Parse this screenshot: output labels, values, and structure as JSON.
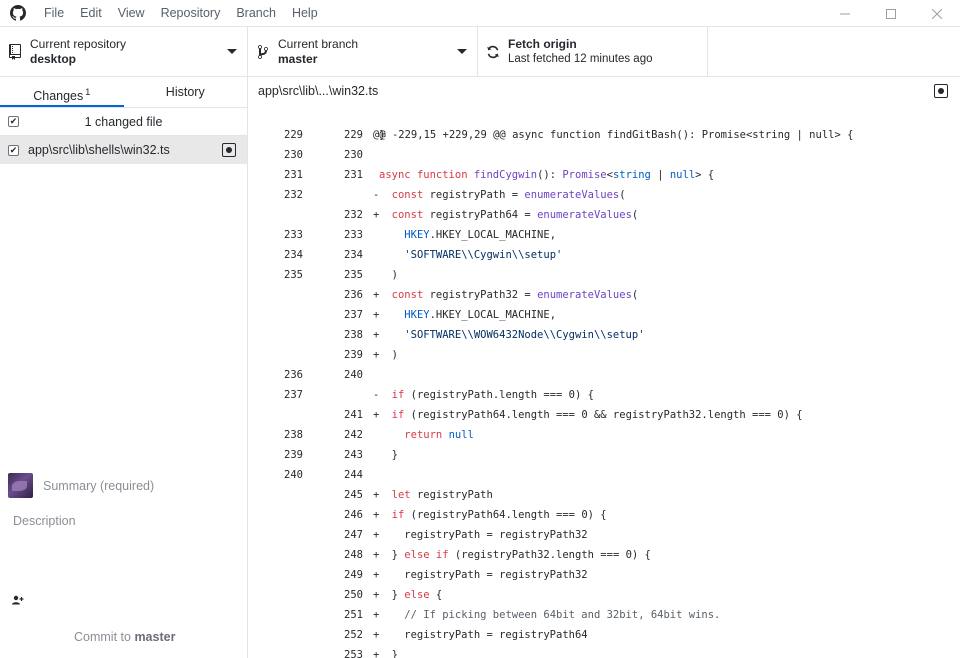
{
  "menu": [
    "File",
    "Edit",
    "View",
    "Repository",
    "Branch",
    "Help"
  ],
  "toolbar": {
    "repo": {
      "desc": "Current repository",
      "name": "desktop"
    },
    "branch": {
      "desc": "Current branch",
      "name": "master"
    },
    "fetch": {
      "title": "Fetch origin",
      "sub": "Last fetched 12 minutes ago"
    }
  },
  "sidebar": {
    "tabs": {
      "changes": "Changes",
      "changes_count": "1",
      "history": "History"
    },
    "changed_files_label": "1 changed file",
    "files": [
      {
        "path": "app\\src\\lib\\shells\\win32.ts"
      }
    ],
    "commit": {
      "summary_placeholder": "Summary (required)",
      "description_placeholder": "Description",
      "coauthor_icon": "+",
      "commit_prefix": "Commit to ",
      "commit_branch": "master"
    }
  },
  "diff": {
    "path": "app\\src\\lib\\...\\win32.ts",
    "hunk": "@@ -229,15 +229,29 @@ async function findGitBash(): Promise<string | null> {",
    "lines": [
      {
        "old": "229",
        "new": "229",
        "m": "",
        "code": "}"
      },
      {
        "old": "230",
        "new": "230",
        "m": "",
        "code": ""
      },
      {
        "old": "231",
        "new": "231",
        "m": "",
        "code": "async function findCygwin(): Promise<string | null> {"
      },
      {
        "old": "232",
        "new": "",
        "m": "-",
        "code": "  const registryPath = enumerateValues("
      },
      {
        "old": "",
        "new": "232",
        "m": "+",
        "code": "  const registryPath64 = enumerateValues("
      },
      {
        "old": "233",
        "new": "233",
        "m": "",
        "code": "    HKEY.HKEY_LOCAL_MACHINE,"
      },
      {
        "old": "234",
        "new": "234",
        "m": "",
        "code": "    'SOFTWARE\\\\Cygwin\\\\setup'"
      },
      {
        "old": "235",
        "new": "235",
        "m": "",
        "code": "  )"
      },
      {
        "old": "",
        "new": "236",
        "m": "+",
        "code": "  const registryPath32 = enumerateValues("
      },
      {
        "old": "",
        "new": "237",
        "m": "+",
        "code": "    HKEY.HKEY_LOCAL_MACHINE,"
      },
      {
        "old": "",
        "new": "238",
        "m": "+",
        "code": "    'SOFTWARE\\\\WOW6432Node\\\\Cygwin\\\\setup'"
      },
      {
        "old": "",
        "new": "239",
        "m": "+",
        "code": "  )"
      },
      {
        "old": "236",
        "new": "240",
        "m": "",
        "code": ""
      },
      {
        "old": "237",
        "new": "",
        "m": "-",
        "code": "  if (registryPath.length === 0) {"
      },
      {
        "old": "",
        "new": "241",
        "m": "+",
        "code": "  if (registryPath64.length === 0 && registryPath32.length === 0) {"
      },
      {
        "old": "238",
        "new": "242",
        "m": "",
        "code": "    return null"
      },
      {
        "old": "239",
        "new": "243",
        "m": "",
        "code": "  }"
      },
      {
        "old": "240",
        "new": "244",
        "m": "",
        "code": ""
      },
      {
        "old": "",
        "new": "245",
        "m": "+",
        "code": "  let registryPath"
      },
      {
        "old": "",
        "new": "246",
        "m": "+",
        "code": "  if (registryPath64.length === 0) {"
      },
      {
        "old": "",
        "new": "247",
        "m": "+",
        "code": "    registryPath = registryPath32"
      },
      {
        "old": "",
        "new": "248",
        "m": "+",
        "code": "  } else if (registryPath32.length === 0) {"
      },
      {
        "old": "",
        "new": "249",
        "m": "+",
        "code": "    registryPath = registryPath32"
      },
      {
        "old": "",
        "new": "250",
        "m": "+",
        "code": "  } else {"
      },
      {
        "old": "",
        "new": "251",
        "m": "+",
        "code": "    // If picking between 64bit and 32bit, 64bit wins."
      },
      {
        "old": "",
        "new": "252",
        "m": "+",
        "code": "    registryPath = registryPath64"
      },
      {
        "old": "",
        "new": "253",
        "m": "+",
        "code": "  }"
      }
    ]
  }
}
